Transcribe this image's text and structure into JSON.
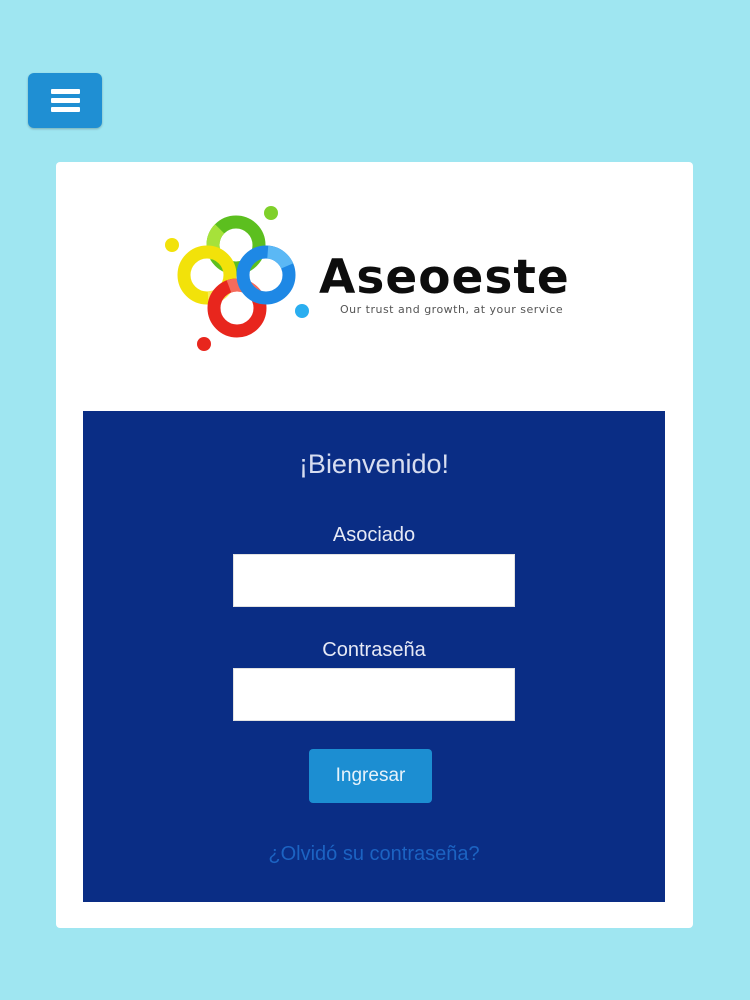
{
  "header": {
    "menu_icon": "hamburger-menu-icon"
  },
  "brand": {
    "name": "Aseoeste",
    "tagline": "Our trust and growth, at your service",
    "logo_icon": "aseoeste-logo-rings-icon",
    "colors": {
      "green": "#5cbf1f",
      "yellow": "#f2e20a",
      "blue": "#1e88e5",
      "red": "#e8261d",
      "light_blue": "#2aaef0"
    }
  },
  "login": {
    "welcome": "¡Bienvenido!",
    "user_label": "Asociado",
    "user_value": "",
    "password_label": "Contraseña",
    "password_value": "",
    "submit_label": "Ingresar",
    "forgot_link": "¿Olvidó su contraseña?"
  },
  "colors": {
    "page_background": "#9fe6f1",
    "panel_background": "#0a2d85",
    "button_accent": "#1c8ed2",
    "link": "#1c63c2"
  }
}
